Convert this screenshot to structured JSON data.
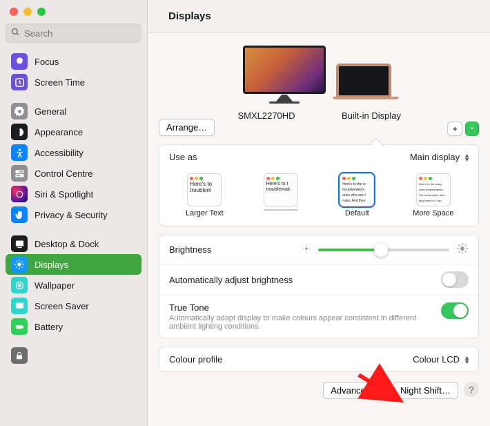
{
  "window": {
    "title": "Displays"
  },
  "search": {
    "placeholder": "Search"
  },
  "sidebar": {
    "items": [
      {
        "label": "Focus"
      },
      {
        "label": "Screen Time"
      },
      {
        "label": "General"
      },
      {
        "label": "Appearance"
      },
      {
        "label": "Accessibility"
      },
      {
        "label": "Control Centre"
      },
      {
        "label": "Siri & Spotlight"
      },
      {
        "label": "Privacy & Security"
      },
      {
        "label": "Desktop & Dock"
      },
      {
        "label": "Displays"
      },
      {
        "label": "Wallpaper"
      },
      {
        "label": "Screen Saver"
      },
      {
        "label": "Battery"
      }
    ]
  },
  "arrange_label": "Arrange…",
  "displays": {
    "external_name": "SMXL2270HD",
    "builtin_name": "Built-in Display"
  },
  "plus_label": "+",
  "use_as": {
    "label": "Use as",
    "value": "Main display"
  },
  "scaling": {
    "larger": "Larger Text",
    "default": "Default",
    "more": "More Space",
    "sample1": "Here's to\ntroublem",
    "sample2": "Here's to t\ntroublemak",
    "sample3": "Here's to the cr\ntroublemakers.\nones who see t\nrules. And they",
    "sample4": "Here's to the crazy ones\ntroublemakers. The round\nrules. And they have no r\ncan quote them, disagr\nbecause they change"
  },
  "brightness": {
    "label": "Brightness",
    "percent": 48
  },
  "auto_brightness": {
    "label": "Automatically adjust brightness",
    "on": false
  },
  "true_tone": {
    "label": "True Tone",
    "desc": "Automatically adapt display to make colours appear consistent in different ambient lighting conditions.",
    "on": true
  },
  "colour_profile": {
    "label": "Colour profile",
    "value": "Colour LCD"
  },
  "buttons": {
    "advanced": "Advanced…",
    "night_shift": "Night Shift…",
    "help": "?"
  }
}
